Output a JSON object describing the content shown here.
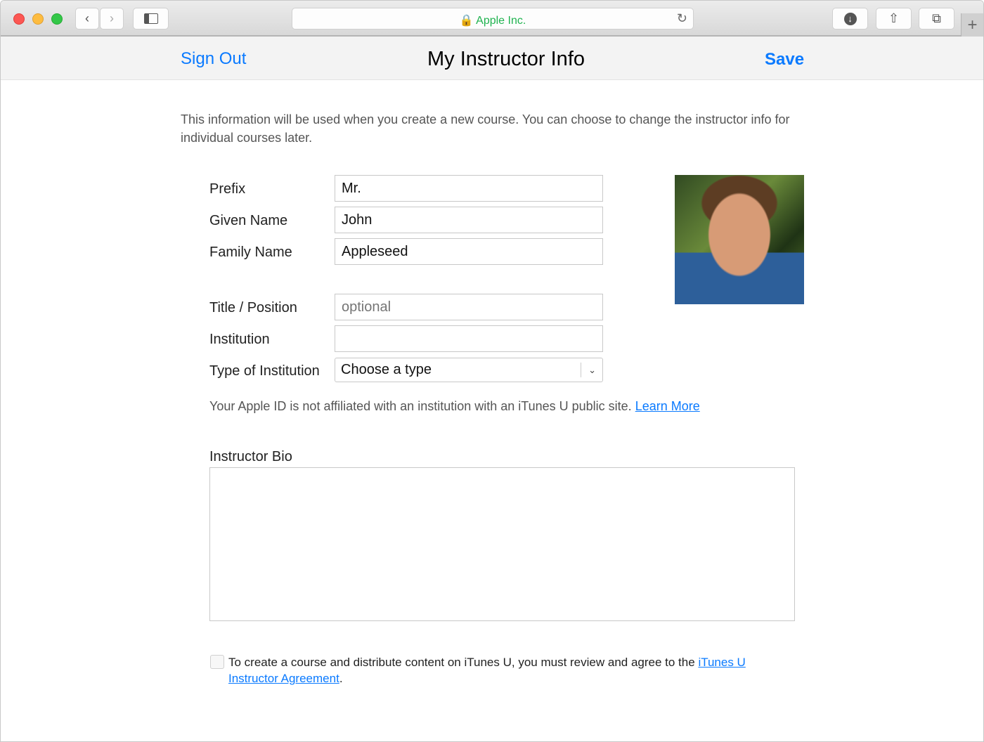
{
  "browser": {
    "address": "Apple Inc.",
    "lock_icon": "lock-icon",
    "tab_plus": "+"
  },
  "nav": {
    "sign_out": "Sign Out",
    "title": "My Instructor Info",
    "save": "Save"
  },
  "intro": "This information will be used when you create a new course. You can choose to change the instructor info for individual courses later.",
  "fields": {
    "prefix": {
      "label": "Prefix",
      "value": "Mr."
    },
    "given": {
      "label": "Given Name",
      "value": "John"
    },
    "family": {
      "label": "Family Name",
      "value": "Appleseed"
    },
    "title": {
      "label": "Title / Position",
      "placeholder": "optional"
    },
    "institution": {
      "label": "Institution",
      "value": ""
    },
    "type": {
      "label": "Type of Institution",
      "value": "Choose a type"
    }
  },
  "note": {
    "text": "Your Apple ID is not affiliated with an institution with an iTunes U public site.",
    "link": "Learn More"
  },
  "bio": {
    "label": "Instructor Bio",
    "value": ""
  },
  "agreement": {
    "text": "To create a course and distribute content on iTunes U, you must review and agree to the",
    "link": "iTunes U Instructor Agreement",
    "end": "."
  }
}
